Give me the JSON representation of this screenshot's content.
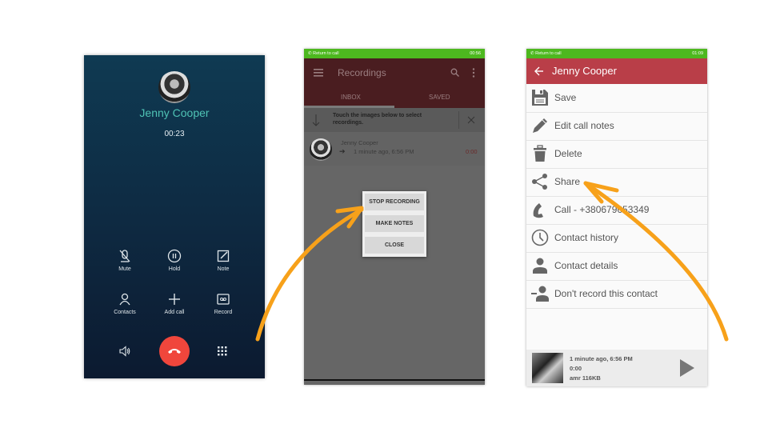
{
  "call_screen": {
    "contact_name": "Jenny Cooper",
    "timer": "00:23",
    "controls": [
      {
        "label": "Mute",
        "icon": "mic-off-icon"
      },
      {
        "label": "Hold",
        "icon": "pause-icon"
      },
      {
        "label": "Note",
        "icon": "note-icon"
      },
      {
        "label": "Contacts",
        "icon": "person-icon"
      },
      {
        "label": "Add call",
        "icon": "plus-icon"
      },
      {
        "label": "Record",
        "icon": "record-icon"
      }
    ],
    "bottom": {
      "speaker_icon": "speaker-icon",
      "end_icon": "end-call-icon",
      "dialpad_icon": "dialpad-icon"
    },
    "end_call_color": "#f0463c",
    "name_color": "#4fc3b5"
  },
  "recordings_screen": {
    "status_bar": {
      "label": "Return to call",
      "time": "00:56"
    },
    "title": "Recordings",
    "tabs": [
      {
        "label": "INBOX",
        "active": true
      },
      {
        "label": "SAVED",
        "active": false
      }
    ],
    "banner": "Touch the images below to select recordings.",
    "recording": {
      "name": "Jenny Cooper",
      "time": "1 minute ago, 6:56 PM",
      "duration": "0:00"
    },
    "dialog": {
      "buttons": [
        "STOP RECORDING",
        "MAKE NOTES",
        "CLOSE"
      ]
    }
  },
  "contact_screen": {
    "status_bar": {
      "label": "Return to call",
      "time": "01:09"
    },
    "title": "Jenny Cooper",
    "menu": [
      {
        "label": "Save",
        "icon": "save-icon"
      },
      {
        "label": "Edit call notes",
        "icon": "pencil-icon"
      },
      {
        "label": "Delete",
        "icon": "trash-icon"
      },
      {
        "label": "Share",
        "icon": "share-icon"
      },
      {
        "label": "Call - +380679653349",
        "icon": "phone-icon"
      },
      {
        "label": "Contact history",
        "icon": "clock-icon"
      },
      {
        "label": "Contact details",
        "icon": "person-icon"
      },
      {
        "label": "Don't record this contact",
        "icon": "person-remove-icon"
      }
    ],
    "player": {
      "time": "1 minute ago, 6:56 PM",
      "duration": "0:00",
      "format": "amr 116KB"
    },
    "header_color": "#b93e48",
    "status_color": "#4db81f"
  },
  "annotation_color": "#f7a11a"
}
